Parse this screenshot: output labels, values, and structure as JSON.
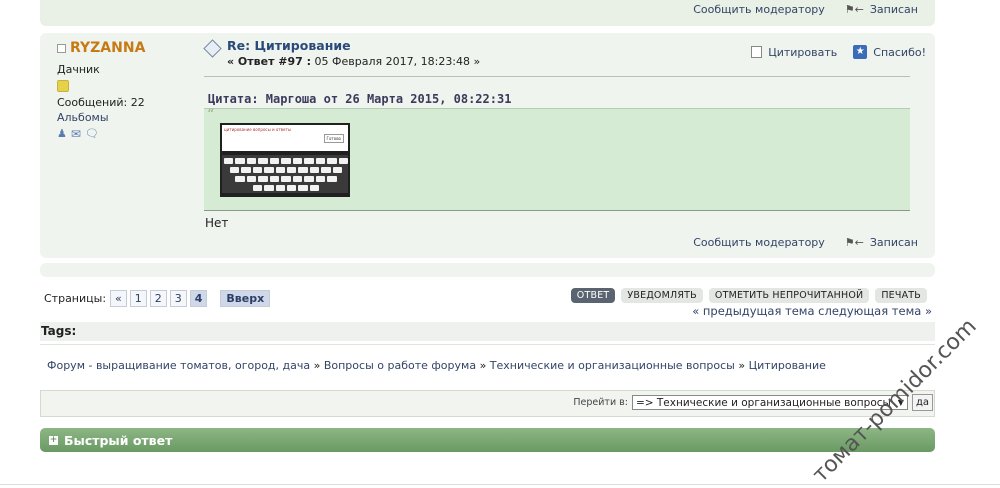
{
  "top_bar": {
    "report": "Сообщить модератору",
    "logged": "Записан"
  },
  "post": {
    "username": "RYZANNA",
    "rank": "Дачник",
    "posts_label": "Сообщений: 22",
    "albums": "Альбомы",
    "title": "Re: Цитирование",
    "meta_prefix": "« Ответ #97 :",
    "meta_date": " 05 Февраля 2017, 18:23:48 »",
    "quote_btn": "Цитировать",
    "thanks_btn": "Спасибо!",
    "quote_header": "Цитата: Маргоша от 26 Марта 2015, 08:22:31",
    "quote_image_text": "цитирование вопросы и ответы",
    "quote_image_button": "Готово",
    "body": "Нет",
    "report": "Сообщить модератору",
    "logged": "Записан"
  },
  "pagination": {
    "label": "Страницы:",
    "prev": "«",
    "pages": [
      "1",
      "2",
      "3",
      "4"
    ],
    "current": "4",
    "top": "Вверх"
  },
  "actions": {
    "reply": "ОТВЕТ",
    "notify": "УВЕДОМЛЯТЬ",
    "mark_unread": "ОТМЕТИТЬ НЕПРОЧИТАННОЙ",
    "print": "ПЕЧАТЬ",
    "prev_next": "« предыдущая тема следующая тема »"
  },
  "tags_label": "Tags:",
  "breadcrumb": {
    "items": [
      "Форум - выращивание томатов, огород, дача",
      "Вопросы о работе форума",
      "Технические и организационные вопросы",
      "Цитирование"
    ],
    "sep": "»"
  },
  "jump": {
    "label": "Перейти в:",
    "selected": "=> Технические и организационные вопросы",
    "go": "да"
  },
  "quick_reply": {
    "label": "Быстрый ответ"
  },
  "watermark": "томат-pomidor.com"
}
